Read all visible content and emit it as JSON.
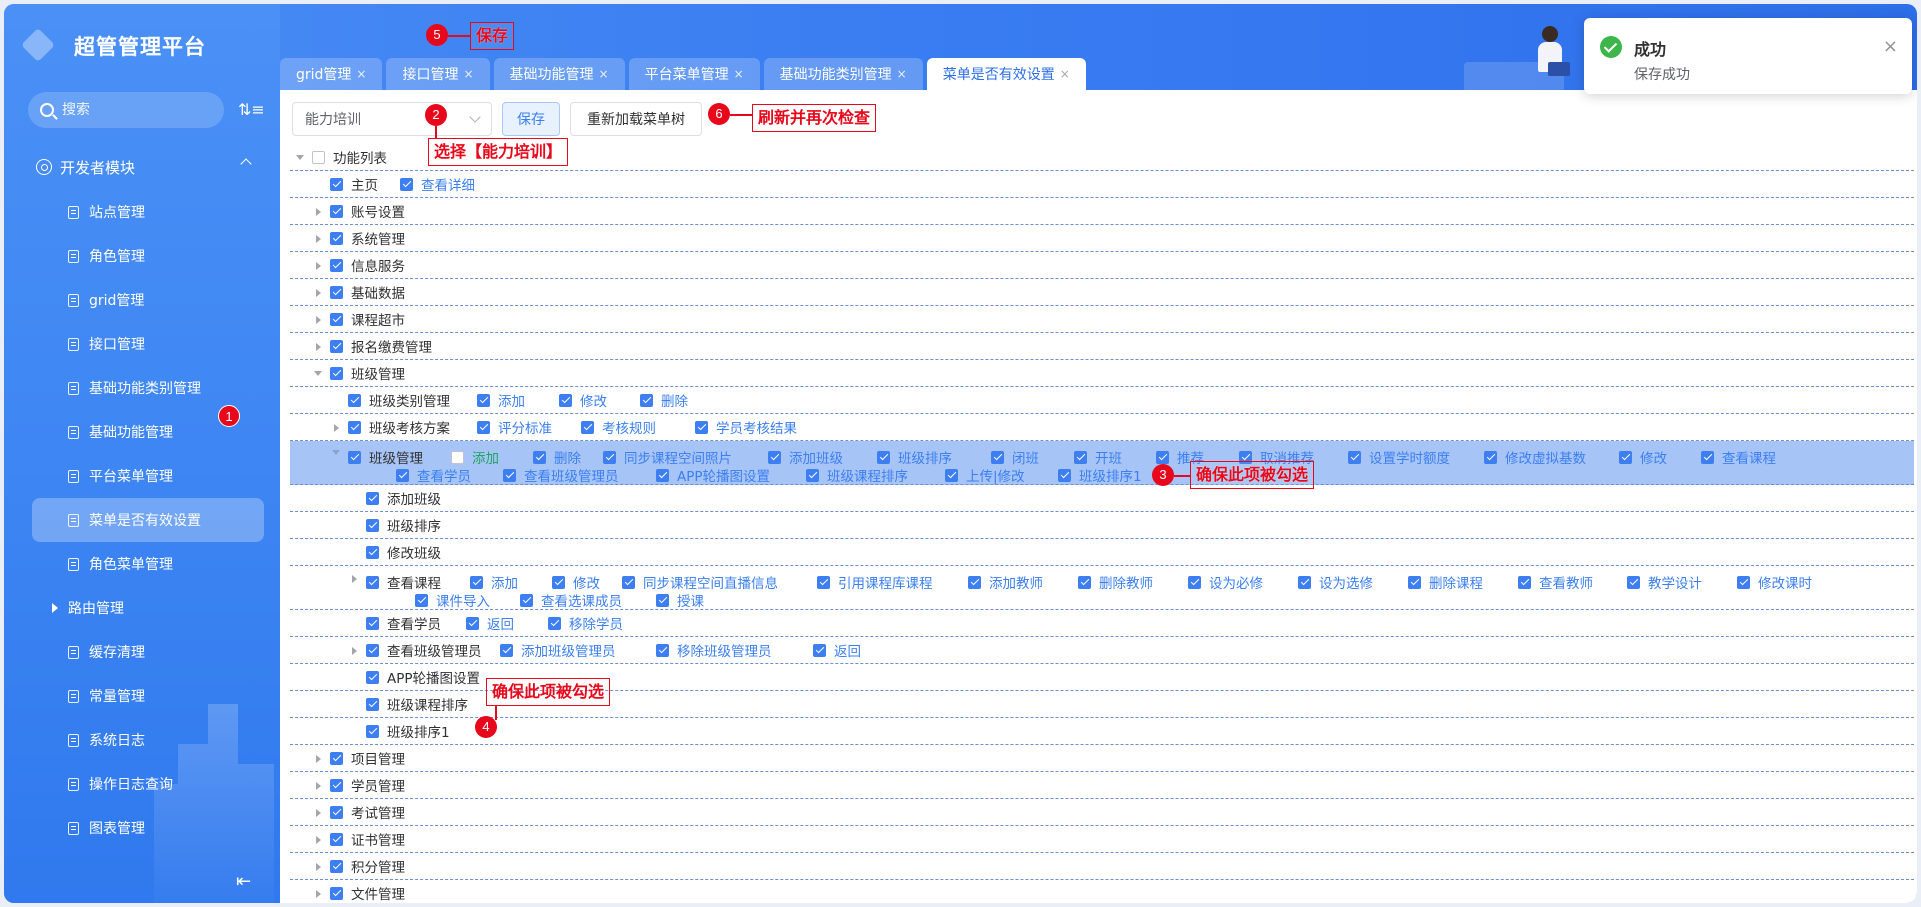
{
  "app": {
    "title": "超管管理平台"
  },
  "sidebar": {
    "search_placeholder": "搜索",
    "group_label": "开发者模块",
    "items": [
      {
        "label": "站点管理"
      },
      {
        "label": "角色管理"
      },
      {
        "label": "grid管理"
      },
      {
        "label": "接口管理"
      },
      {
        "label": "基础功能类别管理"
      },
      {
        "label": "基础功能管理"
      },
      {
        "label": "平台菜单管理"
      },
      {
        "label": "菜单是否有效设置",
        "active": true
      },
      {
        "label": "角色菜单管理"
      },
      {
        "label": "路由管理",
        "expandable": true
      },
      {
        "label": "缓存清理"
      },
      {
        "label": "常量管理"
      },
      {
        "label": "系统日志"
      },
      {
        "label": "操作日志查询"
      },
      {
        "label": "图表管理"
      }
    ]
  },
  "tabs": [
    {
      "label": "grid管理",
      "close": "×"
    },
    {
      "label": "接口管理",
      "close": "×"
    },
    {
      "label": "基础功能管理",
      "close": "×"
    },
    {
      "label": "平台菜单管理",
      "close": "×"
    },
    {
      "label": "基础功能类别管理",
      "close": "×"
    },
    {
      "label": "菜单是否有效设置",
      "close": "×",
      "active": true
    }
  ],
  "toolbar": {
    "select_value": "能力培训",
    "save_label": "保存",
    "reload_label": "重新加载菜单树"
  },
  "toast": {
    "title": "成功",
    "message": "保存成功",
    "close": "×"
  },
  "annotations": {
    "b1": "1",
    "b2": "2",
    "b3": "3",
    "b4": "4",
    "b5": "5",
    "b6": "6",
    "c2": "选择【能力培训】",
    "c3": "确保此项被勾选",
    "c4": "确保此项被勾选",
    "c5": "保存",
    "c6": "刷新并再次检查"
  },
  "tree": {
    "root": "功能列表",
    "home": "主页",
    "home_detail": "查看详细",
    "top": [
      "账号设置",
      "系统管理",
      "信息服务",
      "基础数据",
      "课程超市",
      "报名缴费管理"
    ],
    "class_mgmt": "班级管理",
    "class_type": "班级类别管理",
    "class_type_actions": [
      "添加",
      "修改",
      "删除"
    ],
    "assess": "班级考核方案",
    "assess_actions": [
      "评分标准",
      "考核规则",
      "学员考核结果"
    ],
    "class_mgmt_inner": "班级管理",
    "inner_actions_line1": [
      "添加",
      "删除",
      "同步课程空间照片",
      "添加班级",
      "班级排序",
      "闭班",
      "开班",
      "推荐",
      "取消推荐",
      "设置学时额度",
      "修改虚拟基数",
      "修改",
      "查看课程"
    ],
    "inner_actions_line2": [
      "查看学员",
      "查看班级管理员",
      "APP轮播图设置",
      "班级课程排序",
      "上传|修改",
      "班级排序1"
    ],
    "children": {
      "add_class": "添加班级",
      "sort_class": "班级排序",
      "edit_class": "修改班级",
      "view_course": "查看课程",
      "view_course_actions_line1": [
        "添加",
        "修改",
        "同步课程空间直播信息",
        "引用课程库课程",
        "添加教师",
        "删除教师",
        "设为必修",
        "设为选修",
        "删除课程",
        "查看教师",
        "教学设计",
        "修改课时"
      ],
      "view_course_actions_line2": [
        "课件导入",
        "查看选课成员",
        "授课"
      ],
      "view_student": "查看学员",
      "view_student_actions": [
        "返回",
        "移除学员"
      ],
      "view_admin": "查看班级管理员",
      "view_admin_actions": [
        "添加班级管理员",
        "移除班级管理员",
        "返回"
      ],
      "app_banner": "APP轮播图设置",
      "course_sort": "班级课程排序",
      "class_sort1": "班级排序1"
    },
    "bottom": [
      "项目管理",
      "学员管理",
      "考试管理",
      "证书管理",
      "积分管理",
      "文件管理"
    ]
  }
}
